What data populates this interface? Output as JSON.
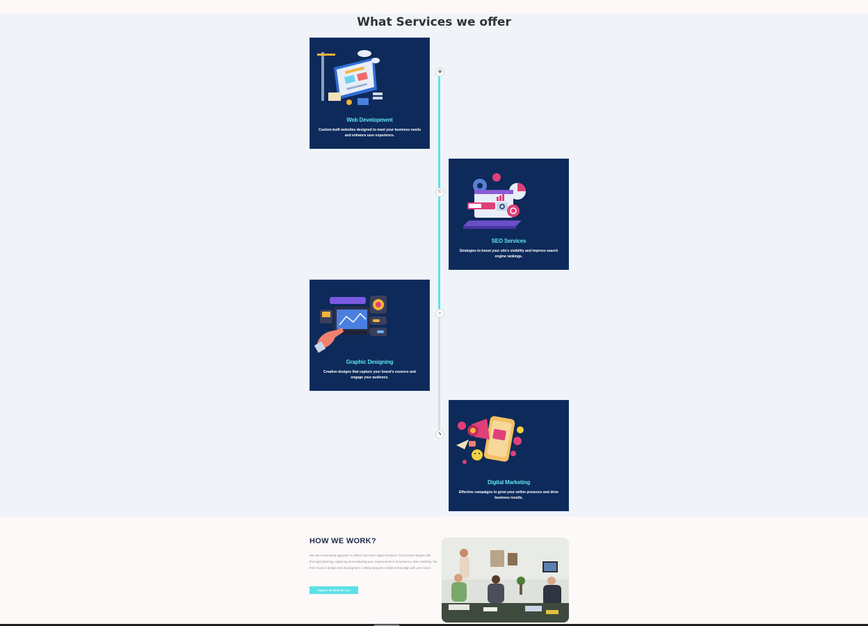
{
  "services": {
    "title": "What Services we offer",
    "cards": [
      {
        "title": "Web Development",
        "description": "Custom-built websites designed to meet your business needs and enhance user experience.",
        "illustration": "web-development-illustration",
        "marker_icon": "gear-icon",
        "marker_glyph": "⊕"
      },
      {
        "title": "SEO Services",
        "description": "Strategies to boost your site's visibility and improve search engine rankings.",
        "illustration": "seo-illustration",
        "marker_icon": "flag-icon",
        "marker_glyph": "⚐"
      },
      {
        "title": "Graphic Designing",
        "description": "Creative designs that capture your brand's essence and engage your audience.",
        "illustration": "graphic-design-illustration",
        "marker_icon": "bulb-icon",
        "marker_glyph": "♁"
      },
      {
        "title": "Digital Marketing",
        "description": "Effective campaigns to grow your online presence and drive business results.",
        "illustration": "digital-marketing-illustration",
        "marker_icon": "bolt-icon",
        "marker_glyph": "ϟ"
      }
    ]
  },
  "how_we_work": {
    "title": "HOW WE WORK?",
    "text": "We use a structured approach to deliver top-notch digital solutions. Our process begins with thorough planning, capturing and analyzing your requirements to document a clear roadmap. We then move to design and development, crafting bespoke solutions that align with your vision.",
    "button_label": "Explore Of What We Do!",
    "image": "team-meeting-photo"
  },
  "colors": {
    "card_bg": "#0d2a5a",
    "accent": "#5ee0e8",
    "section_bg": "#f0f4f8",
    "page_bg": "#fdf9f8"
  }
}
